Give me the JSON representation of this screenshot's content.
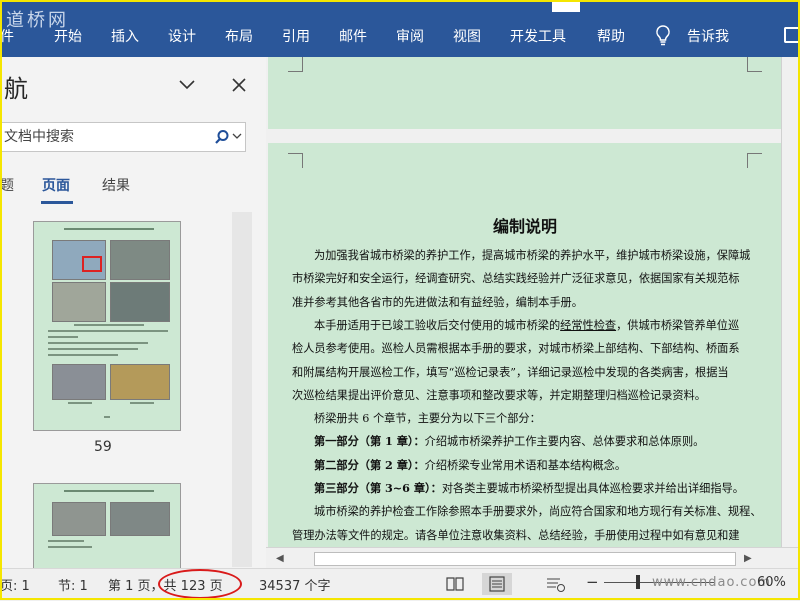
{
  "ribbon": {
    "logo": "道桥网",
    "tabs": [
      "件",
      "开始",
      "插入",
      "设计",
      "布局",
      "引用",
      "邮件",
      "审阅",
      "视图",
      "开发工具",
      "帮助"
    ],
    "tell_me": "告诉我"
  },
  "nav": {
    "title": "航",
    "search_placeholder": "文档中搜索",
    "tabs": [
      "题",
      "页面",
      "结果"
    ],
    "active_tab": "页面",
    "thumb_page_number": "59"
  },
  "document": {
    "title": "编制说明",
    "lines": [
      {
        "indent": true,
        "text": "为加强我省城市桥梁的养护工作，提高城市桥梁的养护水平，维护城市桥梁设施，保障城"
      },
      {
        "indent": false,
        "text": "市桥梁完好和安全运行，经调查研究、总结实践经验并广泛征求意见，依据国家有关规范标"
      },
      {
        "indent": false,
        "text": "准并参考其他各省市的先进做法和有益经验，编制本手册。"
      },
      {
        "indent": true,
        "pre": "本手册适用于已竣工验收后交付使用的城市桥梁的",
        "underline": "经常性检查",
        "post": "，供城市桥梁管养单位巡"
      },
      {
        "indent": false,
        "text": "检人员参考使用。巡检人员需根据本手册的要求，对城市桥梁上部结构、下部结构、桥面系"
      },
      {
        "indent": false,
        "text": "和附属结构开展巡检工作，填写“巡检记录表”，详细记录巡检中发现的各类病害，根据当"
      },
      {
        "indent": false,
        "text": "次巡检结果提出评价意见、注意事项和整改要求等，并定期整理归档巡检记录资料。"
      },
      {
        "indent": true,
        "text": "桥梁册共 6 个章节，主要分为以下三个部分："
      },
      {
        "indent": true,
        "bold": "第一部分（第 1 章）：",
        "post": "介绍城市桥梁养护工作主要内容、总体要求和总体原则。"
      },
      {
        "indent": true,
        "bold": "第二部分（第 2 章）：",
        "post": "介绍桥梁专业常用术语和基本结构概念。"
      },
      {
        "indent": true,
        "bold": "第三部分（第 3~6 章）：",
        "post": "对各类主要城市桥梁桥型提出具体巡检要求并给出详细指导。"
      },
      {
        "indent": true,
        "text": "城市桥梁的养护检查工作除参照本手册要求外，尚应符合国家和地方现行有关标准、规程、"
      },
      {
        "indent": false,
        "text": "管理办法等文件的规定。请各单位注意收集资料、总结经验，手册使用过程中如有意见和建"
      }
    ]
  },
  "status": {
    "page_label": "页: 1",
    "section": "节: 1",
    "page_of": "第 1 页，共 123 页",
    "word_count": "34537 个字",
    "zoom_minus": "−",
    "watermark": "www.cndao.com",
    "zoom": "60%"
  }
}
